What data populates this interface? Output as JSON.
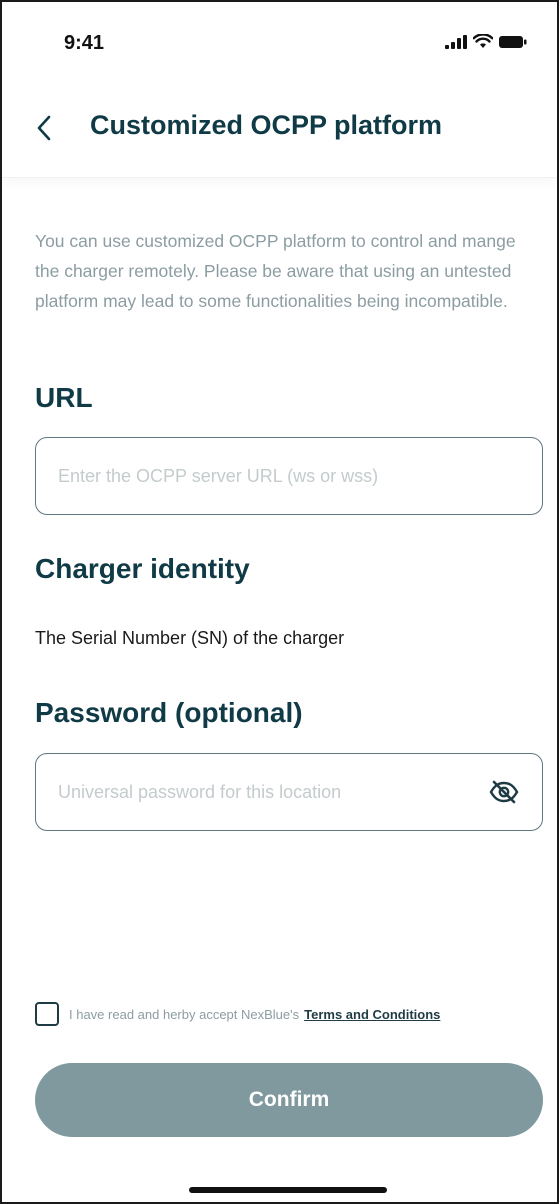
{
  "status_bar": {
    "time": "9:41"
  },
  "header": {
    "title": "Customized OCPP platform"
  },
  "description": "You can use customized OCPP platform to control and mange the charger remotely. Please be aware that using an untested platform may lead to some functionalities being incompatible.",
  "url_section": {
    "label": "URL",
    "value": "",
    "placeholder": "Enter the OCPP server URL (ws or wss)"
  },
  "charger_identity": {
    "label": "Charger identity",
    "value": "The Serial Number (SN) of the charger"
  },
  "password_section": {
    "label": "Password (optional)",
    "value": "",
    "placeholder": "Universal password for this location",
    "toggle_icon": "eye-off-icon"
  },
  "terms": {
    "checked": false,
    "text": "I have read and herby accept NexBlue's",
    "link": "Terms and Conditions"
  },
  "confirm": {
    "label": "Confirm"
  },
  "colors": {
    "title": "#0f3a46",
    "description": "#8c9da2",
    "input_border": "#5f7880",
    "button_bg": "#7f999e"
  }
}
